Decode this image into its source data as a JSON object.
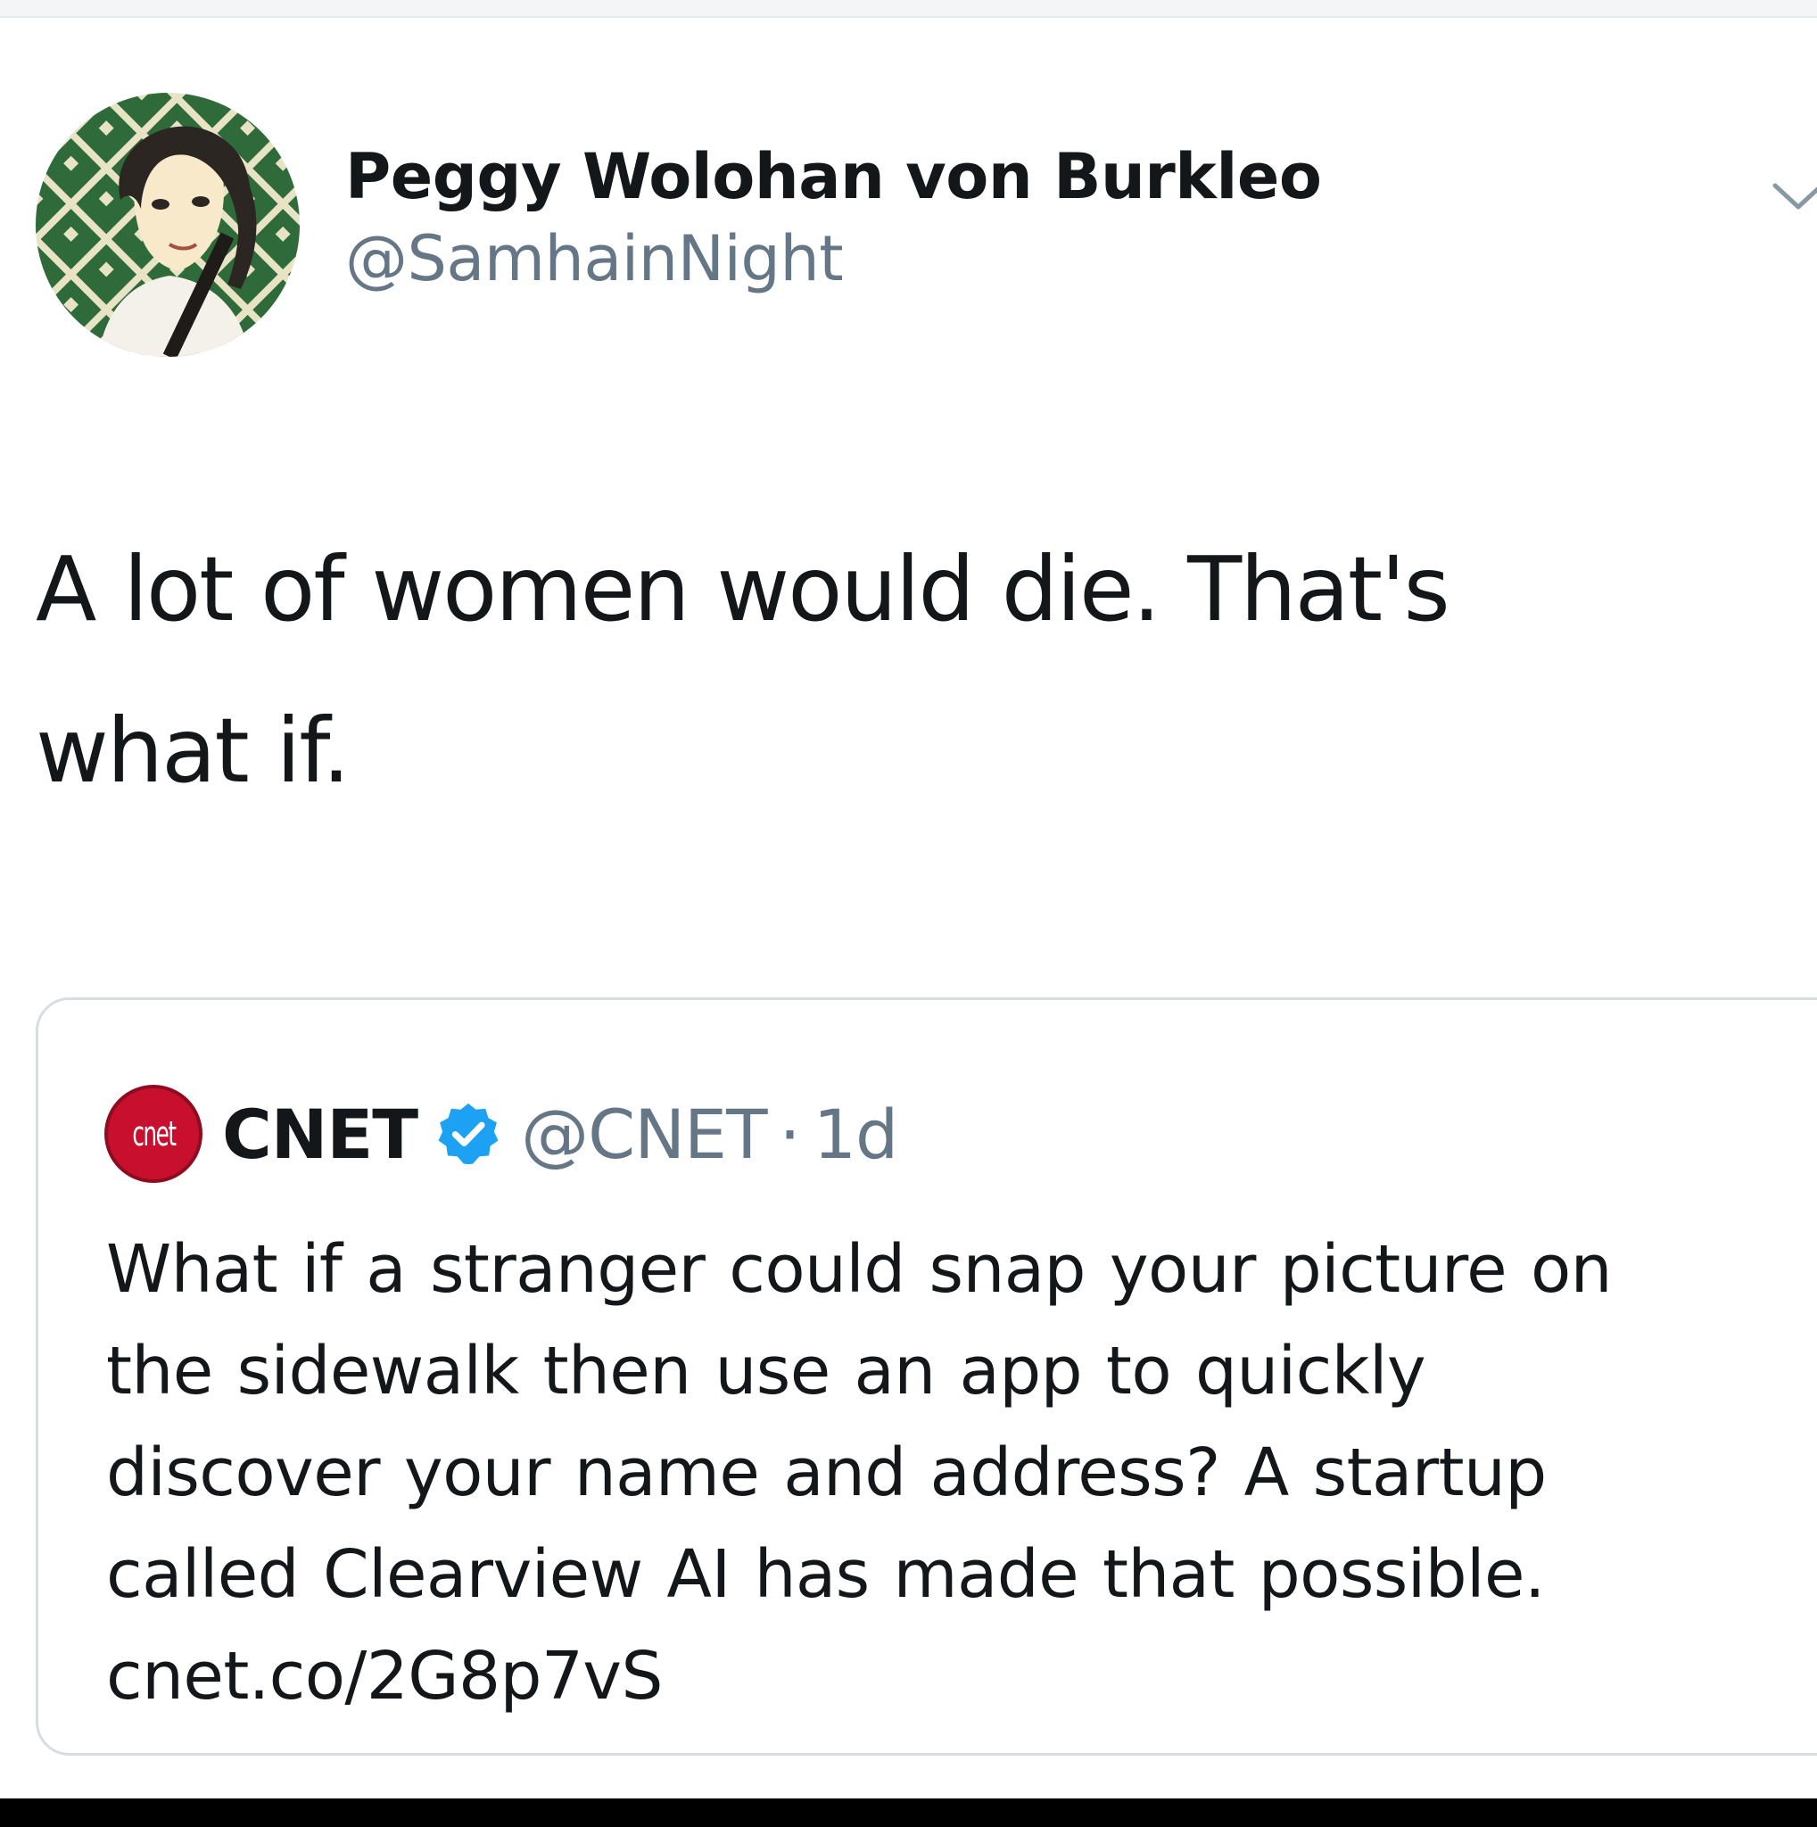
{
  "tweet": {
    "author": {
      "display_name": "Peggy Wolohan von Burkleo",
      "handle": "@SamhainNight"
    },
    "text_line_1": "A lot of women would die. That's",
    "text_line_2": "what if.",
    "menu_icon": "chevron-down-icon",
    "quoted_tweet": {
      "logo_text": "cnet",
      "display_name": "CNET",
      "verified_icon": "verified-badge-icon",
      "handle": "@CNET",
      "separator": "·",
      "time": "1d",
      "text_lines": [
        "What if a stranger could snap your picture on",
        "the sidewalk then use an app to quickly",
        "discover your name and address? A startup",
        "called Clearview AI has made that possible."
      ],
      "link": "cnet.co/2G8p7vS"
    }
  },
  "colors": {
    "text_primary": "#14171a",
    "text_secondary": "#657786",
    "verified_blue": "#1da1f2",
    "cnet_red": "#c8102e",
    "quote_border": "#d8dde2"
  }
}
